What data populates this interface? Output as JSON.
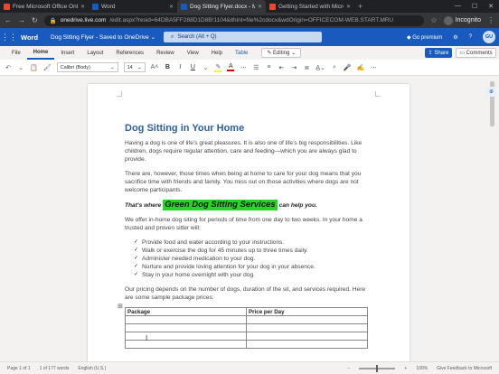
{
  "browser": {
    "tabs": [
      {
        "label": "Free Microsoft Office Online",
        "favicon_color": "#e8492c"
      },
      {
        "label": "Word",
        "favicon_color": "#185abd"
      },
      {
        "label": "Dog Sitting Flyer.docx - Mi",
        "favicon_color": "#185abd",
        "active": true
      },
      {
        "label": "Getting Started with Micro",
        "favicon_color": "#e8492c"
      }
    ],
    "url_host": "onedrive.live.com",
    "url_rest": "/edit.aspx?resid=64DBA5FF288D1D8B!1104&ithint=file%2cdocx&wdOrigin=OFFICECOM-WEB.START.MRU",
    "incognito_label": "Incognito"
  },
  "app": {
    "name": "Word",
    "doc_title": "Dog Sitting Flyer",
    "save_status": "Saved to OneDrive",
    "search_placeholder": "Search (Alt + Q)",
    "premium_label": "Go premium",
    "user_initials": "GU"
  },
  "menu": {
    "items": [
      "File",
      "Home",
      "Insert",
      "Layout",
      "References",
      "Review",
      "View",
      "Help",
      "Table"
    ],
    "editing_label": "Editing",
    "share_label": "Share",
    "comments_label": "Comments"
  },
  "toolbar": {
    "font_name": "Calibri (Body)",
    "font_size": "14"
  },
  "document": {
    "heading": "Dog Sitting in Your Home",
    "para1": "Having a dog is one of life’s great pleasures. It is also one of life’s big responsibilities. Like children, dogs require regular attention, care and feeding—which you are always glad to provide.",
    "para2": "There are, however, those times when being at home to care for your dog means that you sacrifice time with friends and family. You miss out on those activities where dogs are not welcome participants.",
    "tagline_pre": "That’s where",
    "tagline_highlight": "Green Dog Sitting Services",
    "tagline_post": "can help you.",
    "para3": "We offer in-home dog siting for periods of time from one day to two weeks. In your home a trusted and proven sitter will:",
    "bullets": [
      "Provide food and water according to your instructions.",
      "Walk or exercise the dog for 45 minutes up to three times daily.",
      "Administer needed medication to your dog.",
      "Nurture and provide loving attention for your dog in your absence.",
      "Stay in your home overnight with your dog."
    ],
    "para4": "Our pricing depends on the number of dogs, duration of the sit, and services required. Here are some sample package prices:",
    "table_headers": [
      "Package",
      "Price per Day"
    ],
    "highlight_color": "#25d626",
    "heading_color": "#2e5fa0"
  },
  "status": {
    "page": "Page 1 of 1",
    "words": "1 of 177 words",
    "language": "English (U.S.)",
    "zoom": "100%",
    "feedback": "Give Feedback to Microsoft"
  }
}
